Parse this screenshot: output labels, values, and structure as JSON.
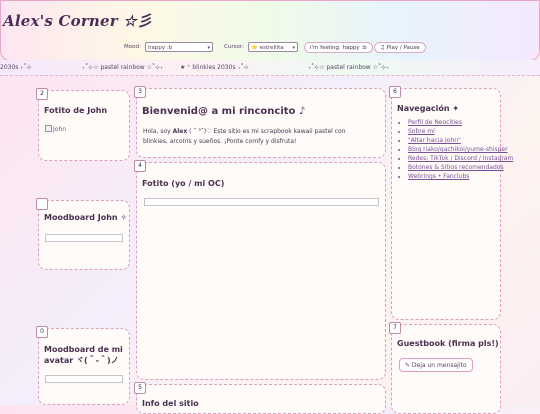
{
  "header": {
    "title": "Alex's Corner ☆彡",
    "mood_label": "Mood:",
    "mood_value": "happy :b",
    "cursor_label": "Cursor:",
    "cursor_value": "⭐ estrellita",
    "feeling_pill": "i'm feeling: happy :b",
    "play_button": "♫ Play / Pause"
  },
  "marquee": [
    "2030s ₊˚⊹",
    "₊˚⊹☆ pastel rainbow ☆˚⊹₊",
    "★ ⁺ blinkies 2030s ₊˚⊹",
    "₊˚⊹☆ pastel rainbow ☆˚⊹₊"
  ],
  "boxes": {
    "fotito": {
      "num": "2",
      "title": "Fotito de John",
      "alt": "John"
    },
    "welcome": {
      "num": "3",
      "title": "Bienvenid@ a mi rinconcito ♪",
      "text_prefix": "Hola, soy ",
      "name": "Alex",
      "text_rest": " ( ˘ ³˘)♡ Este sitio es mi scrapbook kawaii pastel con blinkies, arcoíris y sueños. ¡Ponte comfy y disfruta!"
    },
    "foto_oc": {
      "num": "4",
      "title": "Fotito (yo / mi OC)"
    },
    "info": {
      "num": "5",
      "title": "Info del sitio"
    },
    "nav": {
      "num": "6",
      "title": "Navegación ✦",
      "items": [
        "Perfil de Neocities",
        "Sobre mí",
        "\"Altar hacia John\"",
        "Blog riako/gachikoi/yume-shisper",
        "Redes: TikTok / Discord / Instagram",
        "Botones & Sitios recomendados",
        "Webrings • Fanclubs"
      ]
    },
    "guestbook": {
      "num": "7",
      "title": "Guestbook (firma pls!)",
      "button": "✎ Deja un mensajito"
    },
    "moodboard_john": {
      "num": "",
      "title": "Moodboard John ✧"
    },
    "moodboard_avatar": {
      "num": "0",
      "title": "Moodboard de mi avatar ヾ(＾-＾)ノ"
    }
  }
}
